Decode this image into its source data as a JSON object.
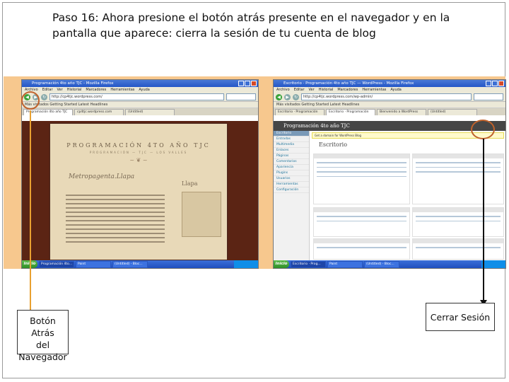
{
  "instruction": {
    "line1": "Paso 16: Ahora presione el botón atrás presente en el navegador y en la",
    "line2": "pantalla que aparece: cierra la sesión de tu cuenta de blog"
  },
  "left_screenshot": {
    "window_title": "Programación 4to año TJC - Mozilla Firefox",
    "menu": [
      "Archivo",
      "Editar",
      "Ver",
      "Historial",
      "Marcadores",
      "Herramientas",
      "Ayuda"
    ],
    "address": "http://cp4tjc.wordpress.com/",
    "bookmarks": "Más visitados   Getting Started   Latest Headlines",
    "tabs": [
      "Programación 4to año TJC",
      "cp4tjc.wordpress.com",
      "(Untitled)"
    ],
    "blog_title": "PROGRAMACIÓN 4TO AÑO TJC",
    "blog_subtitle": "PROGRAMACIÓN — TJC — LOS VALLES",
    "post_title": "Metropagenta.Llapa",
    "side_title": "Llapa",
    "taskbar": {
      "start": "Inicio",
      "tasks": [
        "Programación 4to...",
        "Paint",
        "(Untitled) - Bloc..."
      ]
    }
  },
  "right_screenshot": {
    "window_title": "Escritorio · Programación 4to año TJC — WordPress - Mozilla Firefox",
    "menu": [
      "Archivo",
      "Editar",
      "Ver",
      "Historial",
      "Marcadores",
      "Herramientas",
      "Ayuda"
    ],
    "address": "http://cp4tjc.wordpress.com/wp-admin/",
    "bookmarks": "Más visitados   Getting Started   Latest Headlines",
    "tabs": [
      "Escritorio · Programación",
      "Escritorio · Programación",
      "Bienvenido a WordPress",
      "(Untitled)"
    ],
    "wp_header": "Programación 4to año TJC",
    "notice": "Get a domain for WordPress Blog",
    "dashboard_title": "Escritorio",
    "sidebar": [
      "Escritorio",
      "Entradas",
      "Multimedia",
      "Enlaces",
      "Páginas",
      "Comentarios",
      "Apariencia",
      "Plugins",
      "Usuarios",
      "Herramientas",
      "Configuración"
    ],
    "taskbar": {
      "start": "Inicio",
      "tasks": [
        "Escritorio · Prog...",
        "Paint",
        "(Untitled) - Bloc..."
      ]
    }
  },
  "callouts": {
    "back": {
      "line1": "Botón Atrás",
      "line2": "del",
      "line3": "Navegador"
    },
    "logout": "Cerrar Sesión"
  },
  "colors": {
    "band": "#f7c88e",
    "circle": "#c0622c",
    "back_line": "#e8a030",
    "logout_line": "#111111"
  }
}
